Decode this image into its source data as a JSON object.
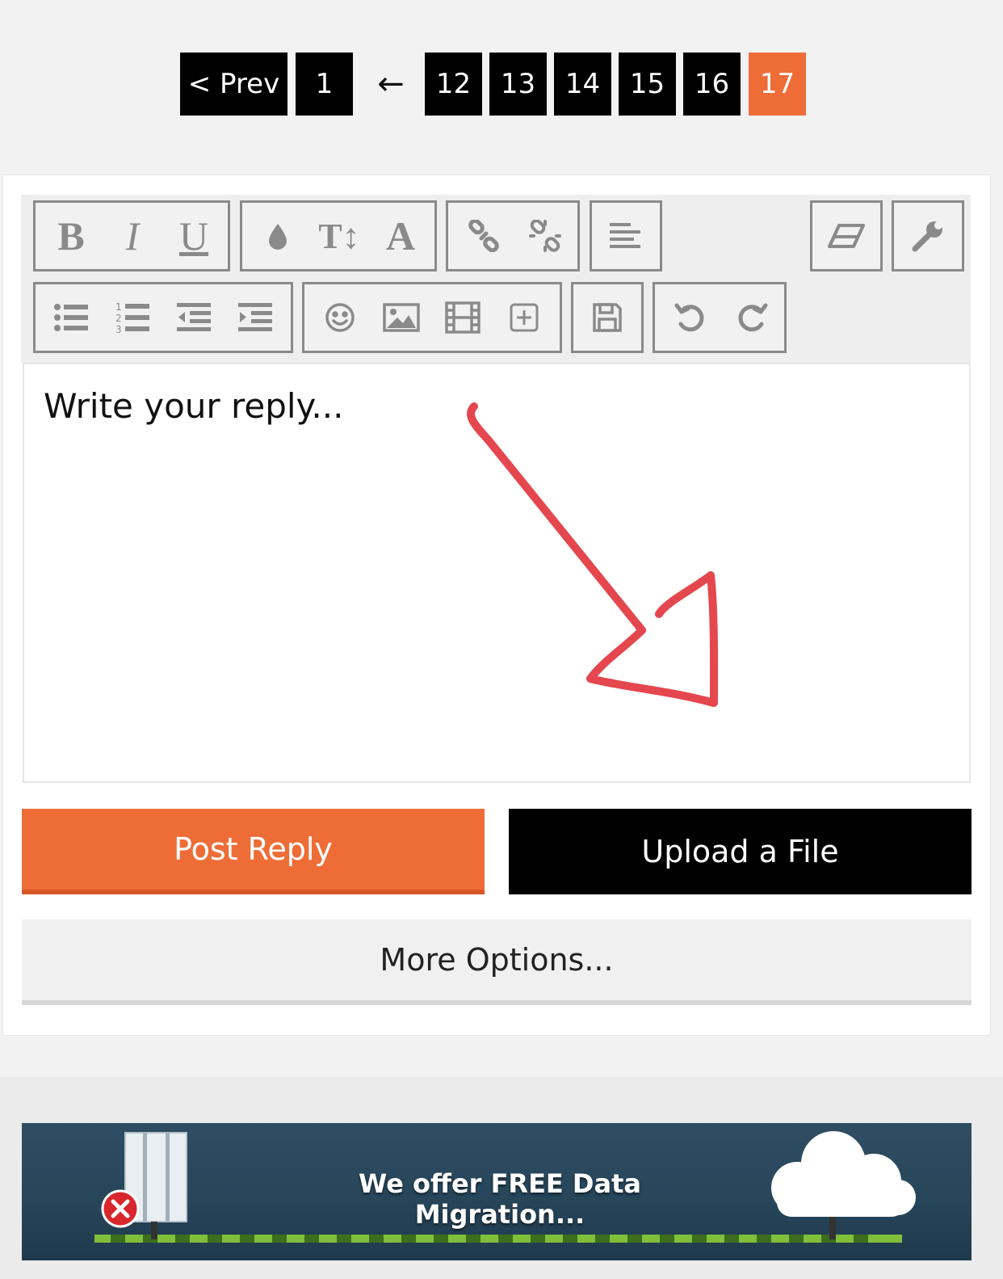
{
  "pagination": {
    "prev_label": "< Prev",
    "first_page": "1",
    "gap_symbol": "←",
    "pages": [
      "12",
      "13",
      "14",
      "15",
      "16",
      "17"
    ],
    "current_page": "17"
  },
  "toolbar": {
    "groups": [
      [
        "bold",
        "italic",
        "underline"
      ],
      [
        "color",
        "font-size",
        "font"
      ],
      [
        "link",
        "unlink"
      ],
      [
        "align"
      ],
      [
        "remove-format"
      ],
      [
        "tools"
      ],
      [
        "bulleted-list",
        "numbered-list",
        "outdent",
        "indent"
      ],
      [
        "emoji",
        "image",
        "video",
        "insert"
      ],
      [
        "save-draft"
      ],
      [
        "undo",
        "redo"
      ]
    ],
    "bold_label": "B",
    "italic_label": "I",
    "underline_label": "U",
    "font_size_label": "T↕",
    "font_label": "A"
  },
  "editor": {
    "placeholder": "Write your reply..."
  },
  "actions": {
    "post_reply": "Post Reply",
    "upload_file": "Upload a File",
    "more_options": "More Options..."
  },
  "ad": {
    "text": "We offer FREE Data Migration..."
  },
  "colors": {
    "accent": "#ee6d37",
    "annotation": "#e5474f"
  }
}
